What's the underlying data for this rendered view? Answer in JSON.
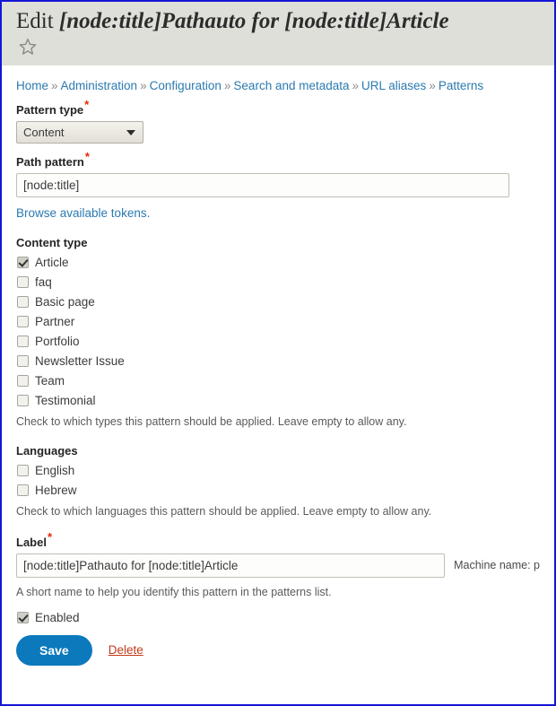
{
  "header": {
    "title_prefix": "Edit",
    "title_value": "[node:title]Pathauto for [node:title]Article",
    "star_icon": "star-outline-icon"
  },
  "breadcrumb": {
    "separator": "»",
    "items": [
      {
        "label": "Home"
      },
      {
        "label": "Administration"
      },
      {
        "label": "Configuration"
      },
      {
        "label": "Search and metadata"
      },
      {
        "label": "URL aliases"
      },
      {
        "label": "Patterns"
      }
    ]
  },
  "form": {
    "pattern_type": {
      "label": "Pattern type",
      "required_marker": "*",
      "value": "Content",
      "options": [
        "Content"
      ]
    },
    "path_pattern": {
      "label": "Path pattern",
      "required_marker": "*",
      "value": "[node:title]",
      "placeholder": "",
      "token_link": "Browse available tokens."
    },
    "content_type": {
      "title": "Content type",
      "items": [
        {
          "label": "Article",
          "checked": true
        },
        {
          "label": "faq",
          "checked": false
        },
        {
          "label": "Basic page",
          "checked": false
        },
        {
          "label": "Partner",
          "checked": false
        },
        {
          "label": "Portfolio",
          "checked": false
        },
        {
          "label": "Newsletter Issue",
          "checked": false
        },
        {
          "label": "Team",
          "checked": false
        },
        {
          "label": "Testimonial",
          "checked": false
        }
      ],
      "description": "Check to which types this pattern should be applied. Leave empty to allow any."
    },
    "languages": {
      "title": "Languages",
      "items": [
        {
          "label": "English",
          "checked": false
        },
        {
          "label": "Hebrew",
          "checked": false
        }
      ],
      "description": "Check to which languages this pattern should be applied. Leave empty to allow any."
    },
    "label_field": {
      "label": "Label",
      "required_marker": "*",
      "value": "[node:title]Pathauto for [node:title]Article",
      "placeholder": "",
      "machine_name": "Machine name: p",
      "description": "A short name to help you identify this pattern in the patterns list."
    },
    "enabled": {
      "label": "Enabled",
      "checked": true
    }
  },
  "actions": {
    "save_label": "Save",
    "delete_label": "Delete"
  },
  "colors": {
    "accent_blue": "#0c79bd",
    "link_blue": "#2a7ab0",
    "required_red": "#e62600",
    "delete_red": "#c4391a",
    "header_band": "#dfdfd9",
    "focus_border": "#1515d6"
  }
}
